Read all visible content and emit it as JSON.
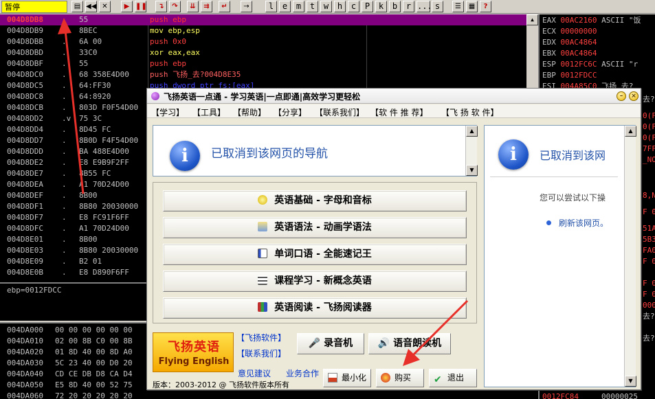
{
  "toolbar": {
    "status": "暂停",
    "letters": [
      "l",
      "e",
      "m",
      "t",
      "w",
      "h",
      "c",
      "P",
      "k",
      "b",
      "r",
      "...",
      "s"
    ]
  },
  "disassembly": {
    "rows": [
      {
        "addr": "004D8DB8",
        "mark": "",
        "hex": "55",
        "asm": "push ebp",
        "selected": true
      },
      {
        "addr": "004D8DB9",
        "mark": ".",
        "hex": "8BEC",
        "asm": "mov ebp,esp"
      },
      {
        "addr": "004D8DBB",
        "mark": ".",
        "hex": "6A 00",
        "asm": "push 0x0"
      },
      {
        "addr": "004D8DBD",
        "mark": ".",
        "hex": "33C0",
        "asm": "xor eax,eax"
      },
      {
        "addr": "004D8DBF",
        "mark": ".",
        "hex": "55",
        "asm": "push ebp"
      },
      {
        "addr": "004D8DC0",
        "mark": ".",
        "hex": "68 358E4D00",
        "asm": "push 飞扬_去?004D8E35"
      },
      {
        "addr": "004D8DC5",
        "mark": ".",
        "hex": "64:FF30",
        "asm": "push dword ptr fs:[eax]"
      },
      {
        "addr": "004D8DC8",
        "mark": ".",
        "hex": "64:8920",
        "asm": ""
      },
      {
        "addr": "004D8DCB",
        "mark": ".",
        "hex": "803D F0F54D00",
        "asm": ""
      },
      {
        "addr": "004D8DD2",
        "mark": ".v",
        "hex": "75 3C",
        "asm": ""
      },
      {
        "addr": "004D8DD4",
        "mark": ".",
        "hex": "8D45 FC",
        "asm": ""
      },
      {
        "addr": "004D8DD7",
        "mark": ".",
        "hex": "8B0D F4F54D00",
        "asm": ""
      },
      {
        "addr": "004D8DDD",
        "mark": ".",
        "hex": "BA 488E4D00",
        "asm": ""
      },
      {
        "addr": "004D8DE2",
        "mark": ".",
        "hex": "E8 E9B9F2FF",
        "asm": ""
      },
      {
        "addr": "004D8DE7",
        "mark": ".",
        "hex": "8B55 FC",
        "asm": ""
      },
      {
        "addr": "004D8DEA",
        "mark": ".",
        "hex": "A1 70D24D00",
        "asm": ""
      },
      {
        "addr": "004D8DEF",
        "mark": ".",
        "hex": "8B00",
        "asm": ""
      },
      {
        "addr": "004D8DF1",
        "mark": ".",
        "hex": "8B80 20030000",
        "asm": ""
      },
      {
        "addr": "004D8DF7",
        "mark": ".",
        "hex": "E8 FC91F6FF",
        "asm": ""
      },
      {
        "addr": "004D8DFC",
        "mark": ".",
        "hex": "A1 70D24D00",
        "asm": ""
      },
      {
        "addr": "004D8E01",
        "mark": ".",
        "hex": "8B00",
        "asm": ""
      },
      {
        "addr": "004D8E03",
        "mark": ".",
        "hex": "8B80 20030000",
        "asm": ""
      },
      {
        "addr": "004D8E09",
        "mark": ".",
        "hex": "B2 01",
        "asm": ""
      },
      {
        "addr": "004D8E0B",
        "mark": ".",
        "hex": "E8 D890F6FF",
        "asm": ""
      }
    ]
  },
  "info": {
    "text": "ebp=0012FDCC"
  },
  "dump": {
    "rows": [
      {
        "addr": "004DA000",
        "hex": "00 00 00 00 00 00"
      },
      {
        "addr": "004DA010",
        "hex": "02 00 8B C0 00 8B"
      },
      {
        "addr": "004DA020",
        "hex": "01 8D 40 00 8D A0"
      },
      {
        "addr": "004DA030",
        "hex": "5C 23 40 00 D0 20"
      },
      {
        "addr": "004DA040",
        "hex": "CD CE DB D8 CA D4"
      },
      {
        "addr": "004DA050",
        "hex": "E5 8D 40 00 52 75"
      },
      {
        "addr": "004DA060",
        "hex": "72 20 20 20 20 20"
      }
    ]
  },
  "registers": {
    "rows": [
      {
        "name": "EAX",
        "value": "00AC2160",
        "extra": "ASCII \"饭"
      },
      {
        "name": "ECX",
        "value": "00000000",
        "extra": ""
      },
      {
        "name": "EDX",
        "value": "00AC4864",
        "extra": ""
      },
      {
        "name": "EBX",
        "value": "00AC4864",
        "extra": ""
      },
      {
        "name": "ESP",
        "value": "0012FC6C",
        "extra": "ASCII \"r"
      },
      {
        "name": "EBP",
        "value": "0012FDCC",
        "extra": ""
      },
      {
        "name": "ESI",
        "value": "004A85C0",
        "extra": "飞扬_去?"
      }
    ],
    "fragments": [
      "去?",
      "0(F",
      "0(F",
      "0(F",
      "7FF",
      "_NO",
      "8,N",
      "F 0",
      "51A",
      "5B3",
      "FA0",
      "F 0",
      "F 0",
      "F 0",
      "000",
      "去?",
      "去?"
    ],
    "bottom": [
      "0012FC84",
      "00000025"
    ]
  },
  "app": {
    "title": "飞扬英语一点通 - 学习英语|一点即通|高效学习更轻松",
    "menu": [
      "【学习】",
      "【工具】",
      "【帮助】",
      "【分享】",
      "【联系我们】",
      "【软 件 推 荐】",
      "【飞 扬 软 件】"
    ],
    "nav_message": "已取消到该网页的导航",
    "courses": [
      {
        "label": "英语基础 - 字母和音标",
        "icon": "lightbulb-icon"
      },
      {
        "label": "英语语法 - 动画学语法",
        "icon": "book-stack-icon"
      },
      {
        "label": "单词口语 - 全能速记王",
        "icon": "word-list-icon"
      },
      {
        "label": "课程学习 - 新概念英语",
        "icon": "course-icon"
      },
      {
        "label": "英语阅读 - 飞扬阅读器",
        "icon": "books-icon"
      }
    ],
    "web": {
      "message": "已取消到该网",
      "subtext": "您可以尝试以下操",
      "refresh_link": "刷新该网页。"
    },
    "logo_cn": "飞扬英语",
    "logo_en": "Flying English",
    "links": {
      "software": "【飞扬软件】",
      "contact": "【联系我们】",
      "feedback": "意见建议",
      "business": "业务合作"
    },
    "tools": {
      "recorder": "录音机",
      "reader": "语音朗读机"
    },
    "buttons": {
      "minimize": "最小化",
      "buy": "购买",
      "exit": "退出"
    },
    "footer": "版本：2003-2012 @ 飞扬软件版本所有",
    "colors": {
      "accent_blue": "#2352a8",
      "logo_red": "#e0200f",
      "arrow_red": "#e8302a"
    }
  }
}
